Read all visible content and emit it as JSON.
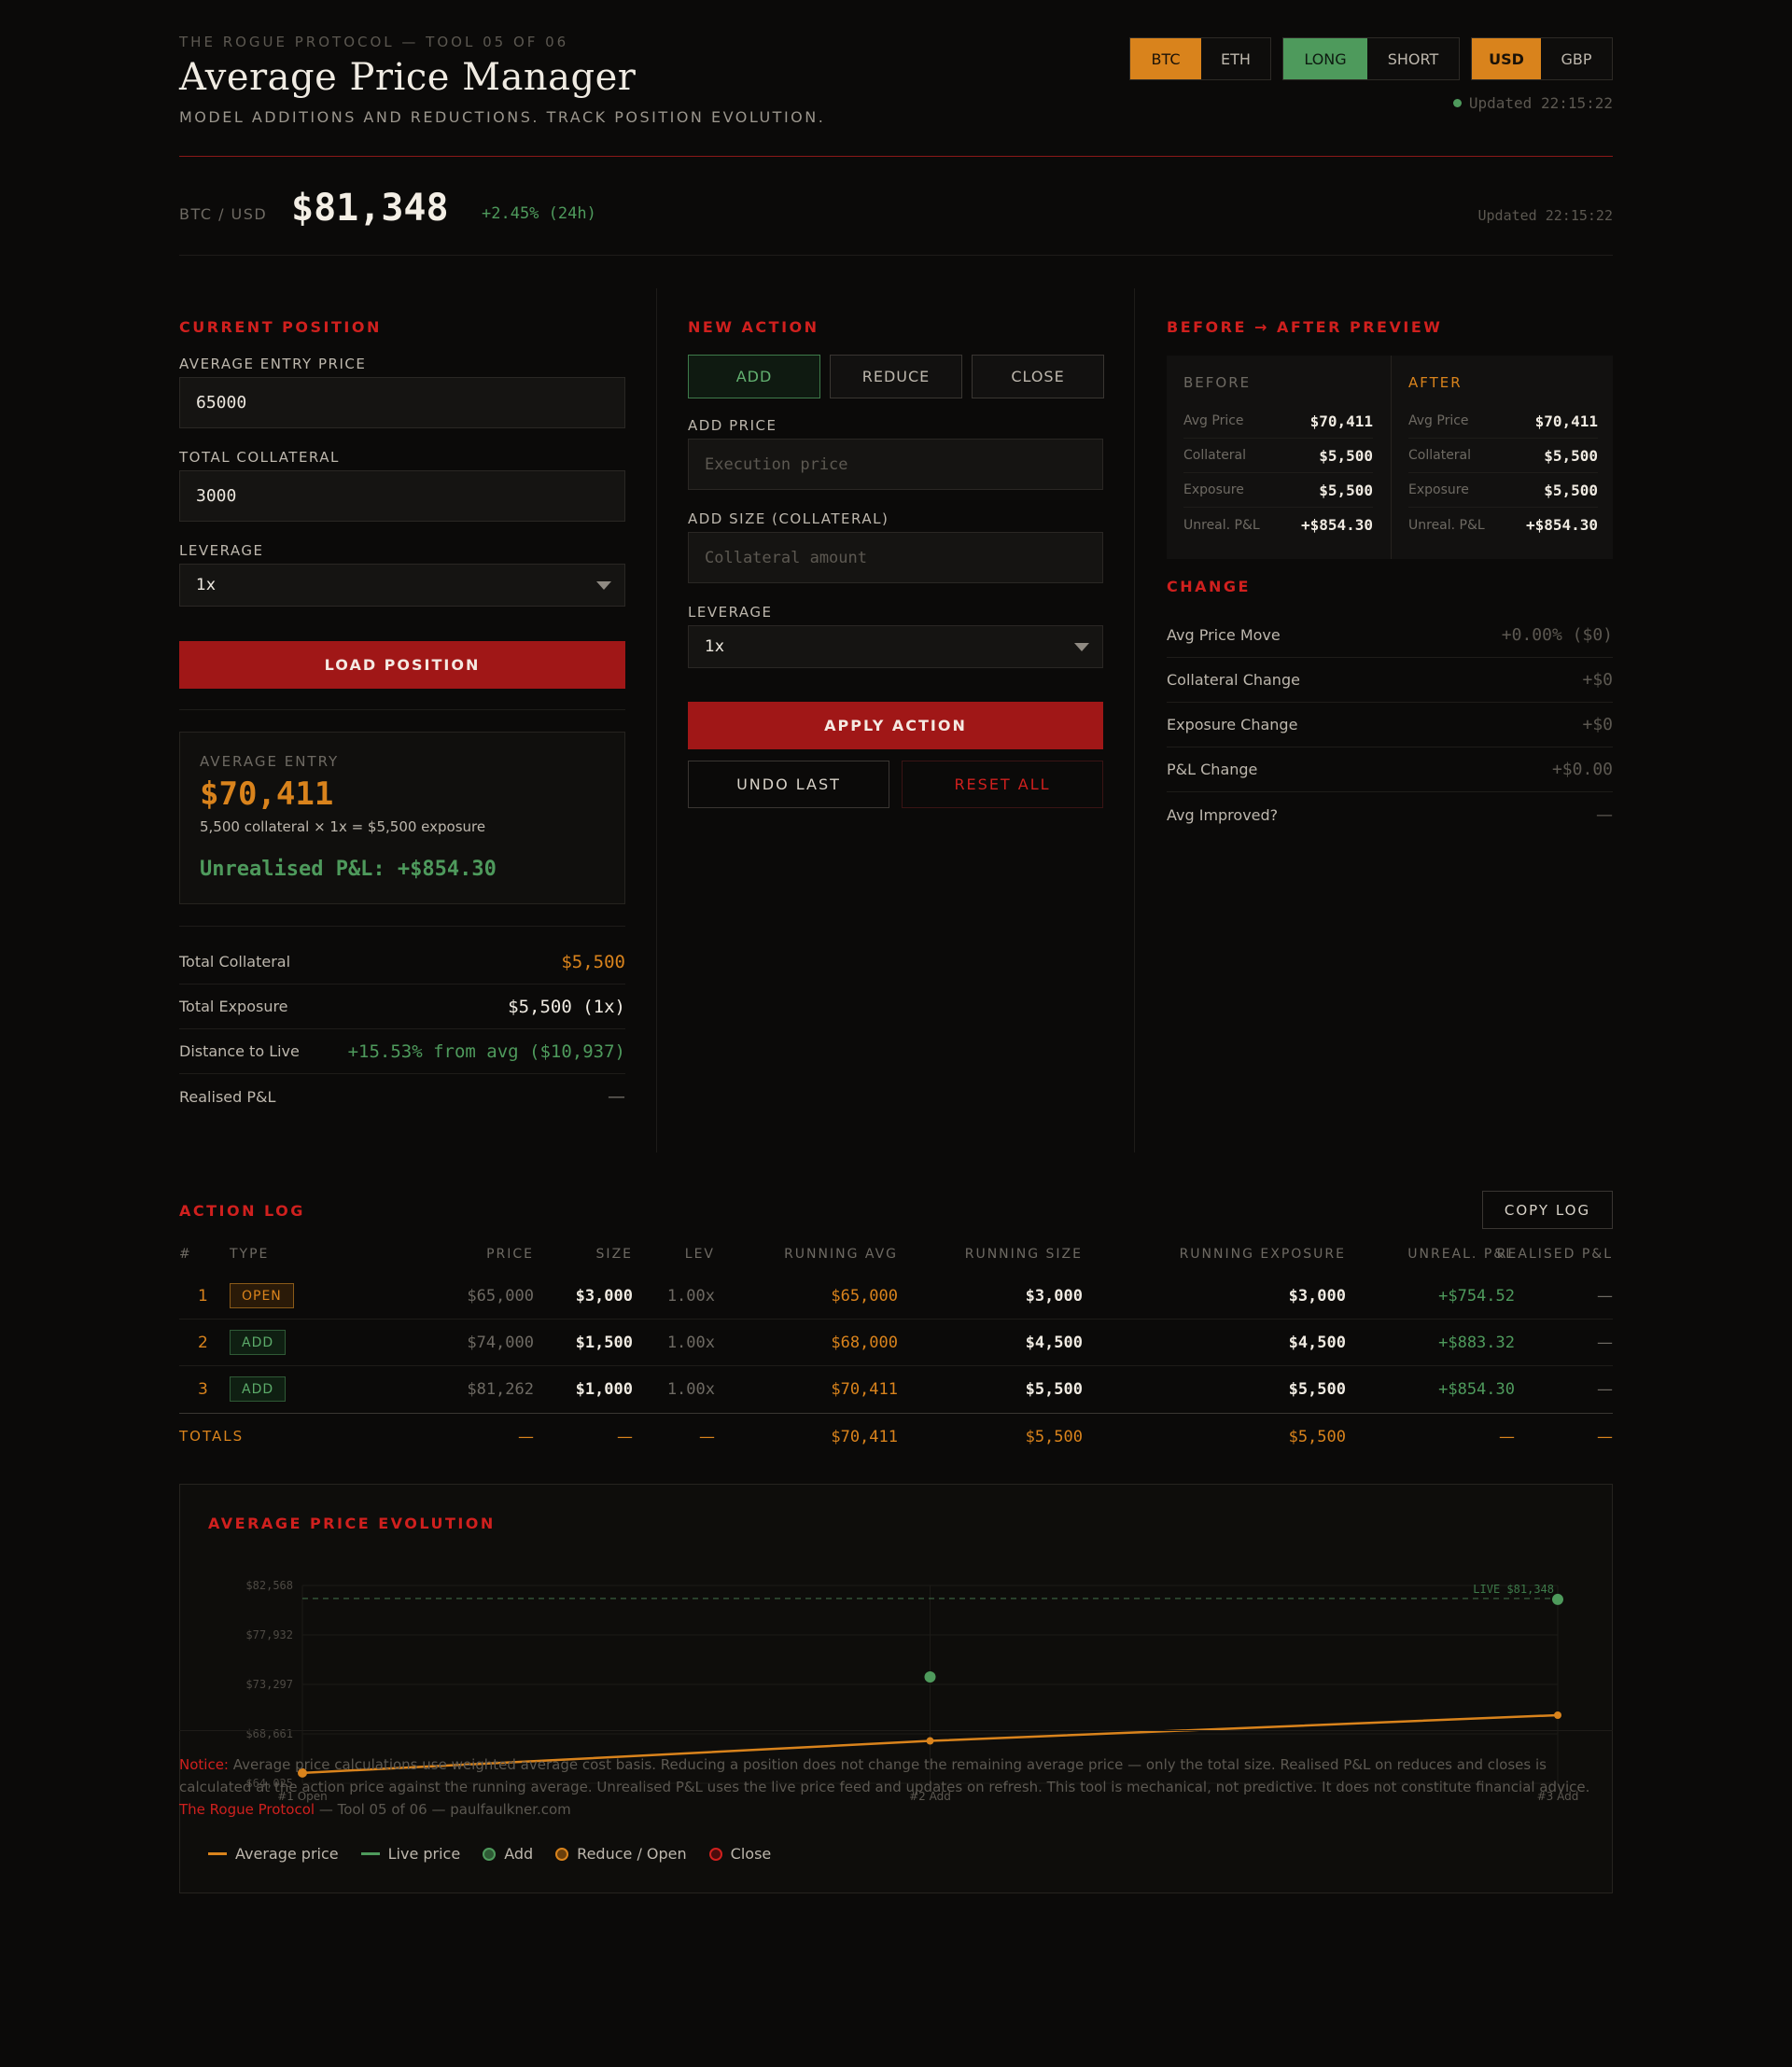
{
  "header": {
    "kicker": "THE ROGUE PROTOCOL — TOOL 05 OF 06",
    "title": "Average Price Manager",
    "subtitle": "MODEL ADDITIONS AND REDUCTIONS. TRACK POSITION EVOLUTION.",
    "asset_toggle": [
      "BTC",
      "ETH"
    ],
    "side_toggle": [
      "LONG",
      "SHORT"
    ],
    "currency_toggle": [
      "USD",
      "GBP"
    ],
    "updated": "Updated 22:15:22"
  },
  "ticker": {
    "pair": "BTC / USD",
    "price": "$81,348",
    "change": "+2.45% (24h)",
    "updated": "Updated 22:15:22"
  },
  "current_position": {
    "title": "CURRENT POSITION",
    "avg_entry_label": "AVERAGE ENTRY PRICE",
    "avg_entry_value": "65000",
    "collateral_label": "TOTAL COLLATERAL",
    "collateral_value": "3000",
    "leverage_label": "LEVERAGE",
    "leverage_value": "1x",
    "load_button": "LOAD POSITION",
    "card": {
      "label": "AVERAGE ENTRY",
      "value": "$70,411",
      "detail": "5,500 collateral × 1x = $5,500 exposure",
      "pnl": "Unrealised P&L: +$854.30"
    },
    "stats": [
      {
        "label": "Total Collateral",
        "value": "$5,500"
      },
      {
        "label": "Total Exposure",
        "value": "$5,500 (1x)"
      },
      {
        "label": "Distance to Live",
        "value": "+15.53% from avg ($10,937)"
      },
      {
        "label": "Realised P&L",
        "value": "—"
      }
    ]
  },
  "new_action": {
    "title": "NEW ACTION",
    "tabs": [
      "ADD",
      "REDUCE",
      "CLOSE"
    ],
    "price_label": "ADD PRICE",
    "price_placeholder": "Execution price",
    "size_label": "ADD SIZE (COLLATERAL)",
    "size_placeholder": "Collateral amount",
    "leverage_label": "LEVERAGE",
    "leverage_value": "1x",
    "apply_button": "APPLY ACTION",
    "undo_button": "UNDO LAST",
    "reset_button": "RESET ALL"
  },
  "preview": {
    "title": "BEFORE → AFTER PREVIEW",
    "before": {
      "head": "BEFORE",
      "rows": [
        {
          "label": "Avg Price",
          "value": "$70,411"
        },
        {
          "label": "Collateral",
          "value": "$5,500"
        },
        {
          "label": "Exposure",
          "value": "$5,500"
        },
        {
          "label": "Unreal. P&L",
          "value": "+$854.30"
        }
      ]
    },
    "after": {
      "head": "AFTER",
      "rows": [
        {
          "label": "Avg Price",
          "value": "$70,411"
        },
        {
          "label": "Collateral",
          "value": "$5,500"
        },
        {
          "label": "Exposure",
          "value": "$5,500"
        },
        {
          "label": "Unreal. P&L",
          "value": "+$854.30"
        }
      ]
    },
    "change_title": "CHANGE",
    "changes": [
      {
        "label": "Avg Price Move",
        "value": "+0.00% ($0)"
      },
      {
        "label": "Collateral Change",
        "value": "+$0"
      },
      {
        "label": "Exposure Change",
        "value": "+$0"
      },
      {
        "label": "P&L Change",
        "value": "+$0.00"
      },
      {
        "label": "Avg Improved?",
        "value": "—"
      }
    ]
  },
  "log": {
    "title": "ACTION LOG",
    "copy_button": "COPY LOG",
    "columns": [
      "#",
      "TYPE",
      "PRICE",
      "SIZE",
      "LEV",
      "RUNNING AVG",
      "RUNNING SIZE",
      "RUNNING EXPOSURE",
      "UNREAL. P&L",
      "REALISED P&L"
    ],
    "rows": [
      {
        "n": "1",
        "type": "OPEN",
        "price": "$65,000",
        "size": "$3,000",
        "lev": "1.00x",
        "ravg": "$65,000",
        "rsize": "$3,000",
        "rexp": "$3,000",
        "upnl": "+$754.52",
        "rpnl": "—"
      },
      {
        "n": "2",
        "type": "ADD",
        "price": "$74,000",
        "size": "$1,500",
        "lev": "1.00x",
        "ravg": "$68,000",
        "rsize": "$4,500",
        "rexp": "$4,500",
        "upnl": "+$883.32",
        "rpnl": "—"
      },
      {
        "n": "3",
        "type": "ADD",
        "price": "$81,262",
        "size": "$1,000",
        "lev": "1.00x",
        "ravg": "$70,411",
        "rsize": "$5,500",
        "rexp": "$5,500",
        "upnl": "+$854.30",
        "rpnl": "—"
      }
    ],
    "totals": {
      "label": "TOTALS",
      "price": "—",
      "size": "—",
      "lev": "—",
      "ravg": "$70,411",
      "rsize": "$5,500",
      "rexp": "$5,500",
      "upnl": "—",
      "rpnl": "—"
    }
  },
  "chart_title": "AVERAGE PRICE EVOLUTION",
  "chart_data": {
    "type": "line",
    "title": "AVERAGE PRICE EVOLUTION",
    "categories": [
      "#1 Open",
      "#2 Add",
      "#3 Add"
    ],
    "y_ticks": [
      "$82,568",
      "$77,932",
      "$73,297",
      "$68,661",
      "$64,025"
    ],
    "ylim": [
      64025,
      82568
    ],
    "series": [
      {
        "name": "Average price",
        "values": [
          65000,
          68000,
          70411
        ],
        "color": "#d9831c"
      },
      {
        "name": "Live price",
        "values": [
          81348,
          81348,
          81348
        ],
        "color": "#4e9a5c"
      }
    ],
    "action_points": [
      {
        "category": "#1 Open",
        "kind": "Reduce / Open",
        "value": 65000
      },
      {
        "category": "#2 Add",
        "kind": "Add",
        "value": 74000
      },
      {
        "category": "#3 Add",
        "kind": "Add",
        "value": 81262
      }
    ],
    "live_label": "LIVE $81,348",
    "legend": [
      "Average price",
      "Live price",
      "Add",
      "Reduce / Open",
      "Close"
    ]
  },
  "notice": {
    "label": "Notice:",
    "text": " Average price calculations use weighted average cost basis. Reducing a position does not change the remaining average price — only the total size. Realised P&L on reduces and closes is calculated at the action price against the running average. Unrealised P&L uses the live price feed and updates on refresh. This tool is mechanical, not predictive. It does not constitute financial advice. ",
    "brand": "The Rogue Protocol",
    "footer": " — Tool 05 of 06 — paulfaulkner.com"
  }
}
